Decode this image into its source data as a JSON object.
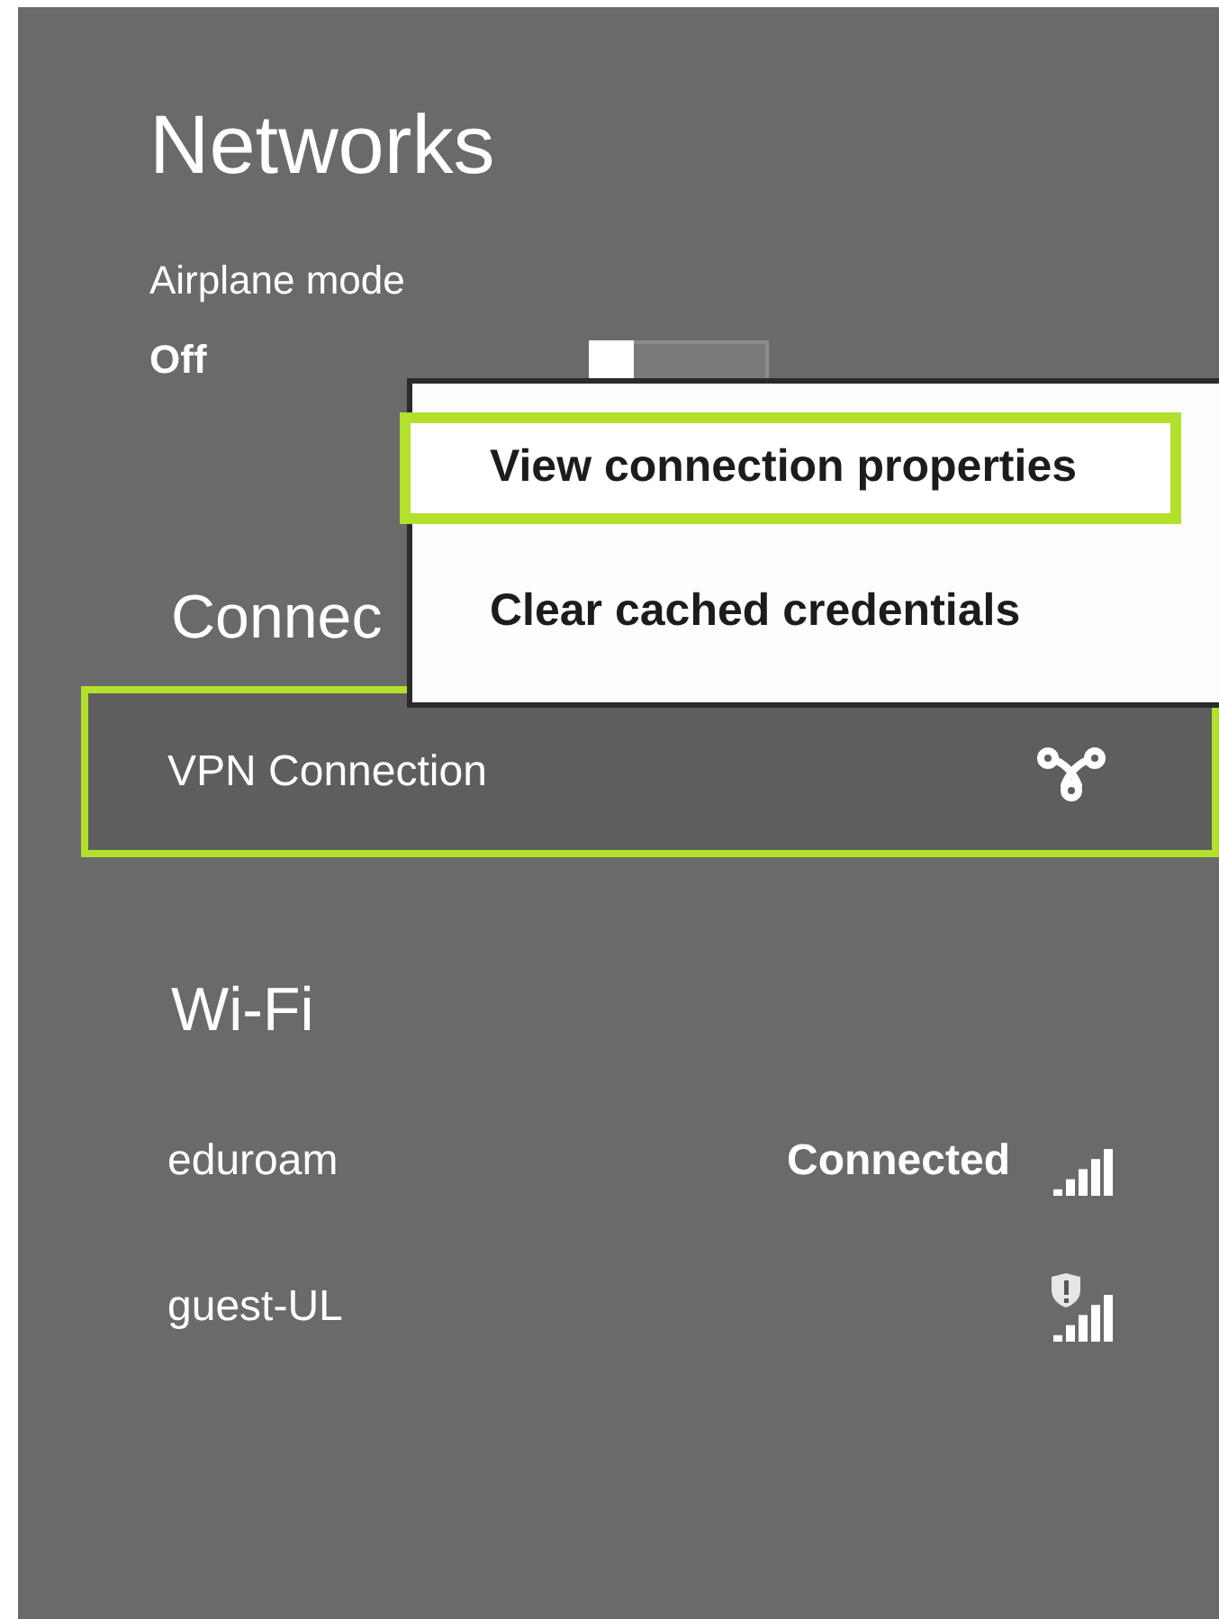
{
  "title": "Networks",
  "airplane_mode": {
    "label": "Airplane mode",
    "value": "Off",
    "on": false
  },
  "context_menu": {
    "items": [
      {
        "label": "View connection properties",
        "highlighted": true
      },
      {
        "label": "Clear cached credentials",
        "highlighted": false
      }
    ]
  },
  "connections": {
    "heading": "Connec",
    "items": [
      {
        "name": "VPN Connection",
        "highlighted": true
      }
    ]
  },
  "wifi": {
    "heading": "Wi-Fi",
    "networks": [
      {
        "name": "eduroam",
        "status": "Connected",
        "security_warning": false
      },
      {
        "name": "guest-UL",
        "security_warning": true
      }
    ]
  }
}
